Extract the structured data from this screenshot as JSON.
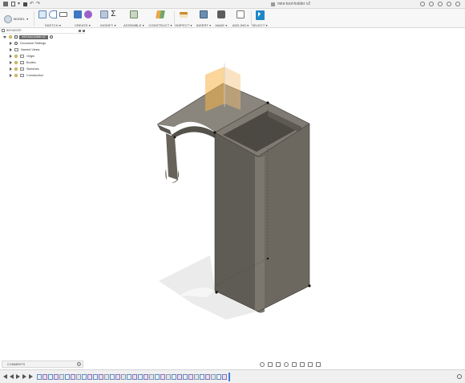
{
  "titlebar": {
    "document_title": "mini-tool-holder v2"
  },
  "toolbar": {
    "workspace": "MODEL",
    "groups": [
      {
        "label": "SKETCH ▾"
      },
      {
        "label": "CREATE ▾"
      },
      {
        "label": "MODIFY ▾"
      },
      {
        "label": "ASSEMBLE ▾"
      },
      {
        "label": "CONSTRUCT ▾"
      },
      {
        "label": "INSPECT ▾"
      },
      {
        "label": "INSERT ▾"
      },
      {
        "label": "MAKE ▾"
      },
      {
        "label": "ADD-INS ▾"
      },
      {
        "label": "SELECT ▾"
      }
    ]
  },
  "browser": {
    "title": "BROWSER",
    "root": "mini-tool-holder v2",
    "items": [
      {
        "label": "Document Settings"
      },
      {
        "label": "Named Views"
      },
      {
        "label": "Origin"
      },
      {
        "label": "Bodies"
      },
      {
        "label": "Sketches"
      },
      {
        "label": "Construction"
      }
    ]
  },
  "comments": {
    "label": "COMMENTS"
  },
  "colors": {
    "model_body": "#6e6a62",
    "model_dark": "#4e4b45",
    "model_light": "#8b877d",
    "viewcube_orange": "#f5b547",
    "select_blue": "#1e88c7",
    "shadow": "#e6e6e6"
  }
}
